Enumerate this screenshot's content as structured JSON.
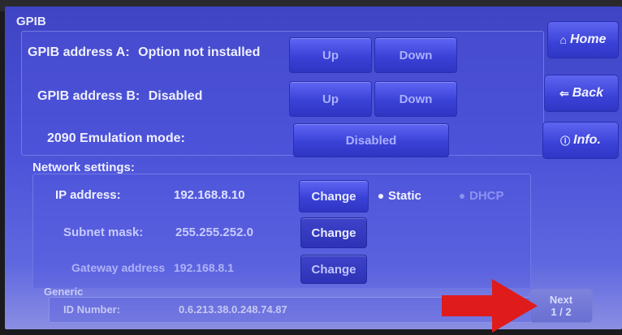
{
  "screen": {
    "title": "GPIB"
  },
  "gpib": {
    "address_a": {
      "label": "GPIB address A:",
      "value": "Option not installed",
      "up": "Up",
      "down": "Down"
    },
    "address_b": {
      "label": "GPIB address B:",
      "value": "Disabled",
      "up": "Up",
      "down": "Down"
    },
    "emulation": {
      "label": "2090 Emulation mode:",
      "value": "Disabled"
    }
  },
  "network": {
    "title": "Network settings:",
    "ip": {
      "label": "IP address:",
      "value": "192.168.8.10",
      "change": "Change"
    },
    "mode": {
      "static": "Static",
      "dhcp": "DHCP",
      "selected": "Static"
    },
    "subnet": {
      "label": "Subnet mask:",
      "value": "255.255.252.0",
      "change": "Change"
    },
    "gateway": {
      "label": "Gateway address",
      "value": "192.168.8.1",
      "change": "Change"
    }
  },
  "generic": {
    "title": "Generic",
    "id_label": "ID Number:",
    "id_value": "0.6.213.38.0.248.74.87"
  },
  "nav": {
    "home": "Home",
    "back": "Back",
    "info": "Info.",
    "next": "Next",
    "page": "1 / 2"
  },
  "colors": {
    "screen_blue": "#4b52d8",
    "button_blue": "#3a41d6",
    "arrow_red": "#e01b1b"
  }
}
